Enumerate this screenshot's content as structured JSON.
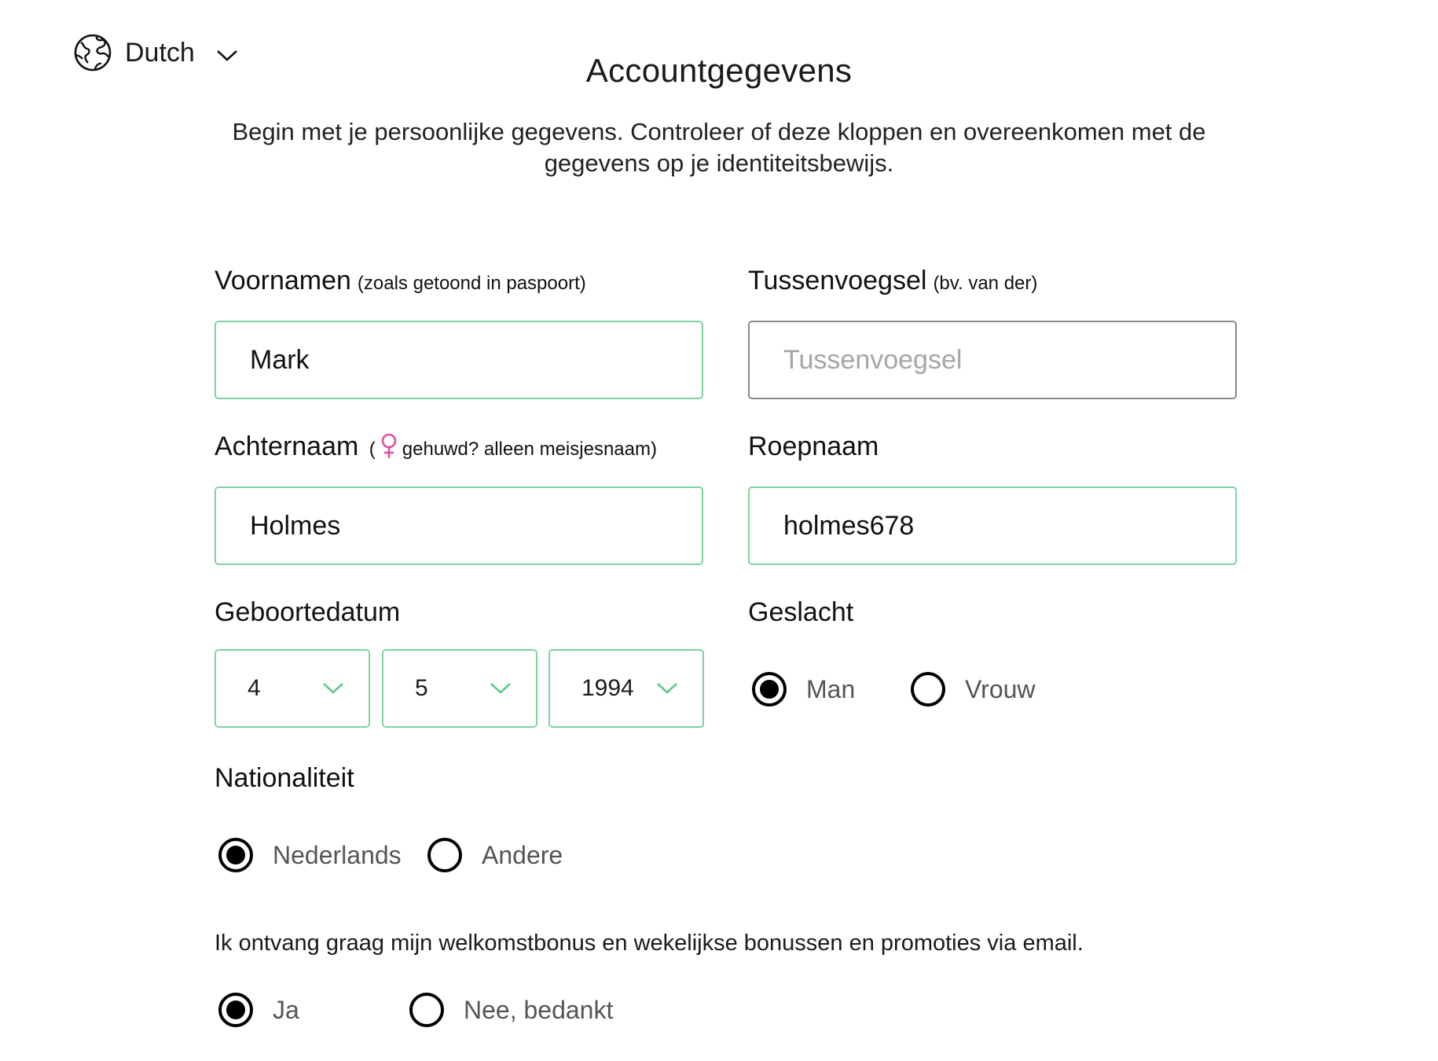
{
  "header": {
    "language": "Dutch",
    "title": "Accountgegevens"
  },
  "intro": "Begin met je persoonlijke gegevens. Controleer of deze kloppen en overeenkomen met de gegevens op je identiteitsbewijs.",
  "form": {
    "first_names": {
      "label": "Voornamen",
      "hint": "(zoals getoond in paspoort)",
      "value": "Mark"
    },
    "infix": {
      "label": "Tussenvoegsel",
      "hint": "(bv. van der)",
      "value": "",
      "placeholder": "Tussenvoegsel"
    },
    "last_name": {
      "label": "Achternaam",
      "hint_open": "(",
      "hint": "gehuwd? alleen meisjesnaam)",
      "value": "Holmes",
      "venus_color": "#e24fa3"
    },
    "nickname": {
      "label": "Roepnaam",
      "value": "holmes678"
    },
    "birthdate": {
      "label": "Geboortedatum",
      "day": "4",
      "month": "5",
      "year": "1994"
    },
    "gender": {
      "label": "Geslacht",
      "options": [
        "Man",
        "Vrouw"
      ],
      "selected": "Man"
    },
    "nationality": {
      "label": "Nationaliteit",
      "options": [
        "Nederlands",
        "Andere"
      ],
      "selected": "Nederlands"
    },
    "promotions": {
      "label": "Ik ontvang graag mijn welkomstbonus en wekelijkse bonussen en promoties via email.",
      "options": [
        "Ja",
        "Nee, bedankt"
      ],
      "selected": "Ja"
    }
  },
  "colors": {
    "accent_border": "#7dd3a0",
    "neutral_border": "#8a8a8a",
    "accent_chevron": "#5cc98a"
  }
}
